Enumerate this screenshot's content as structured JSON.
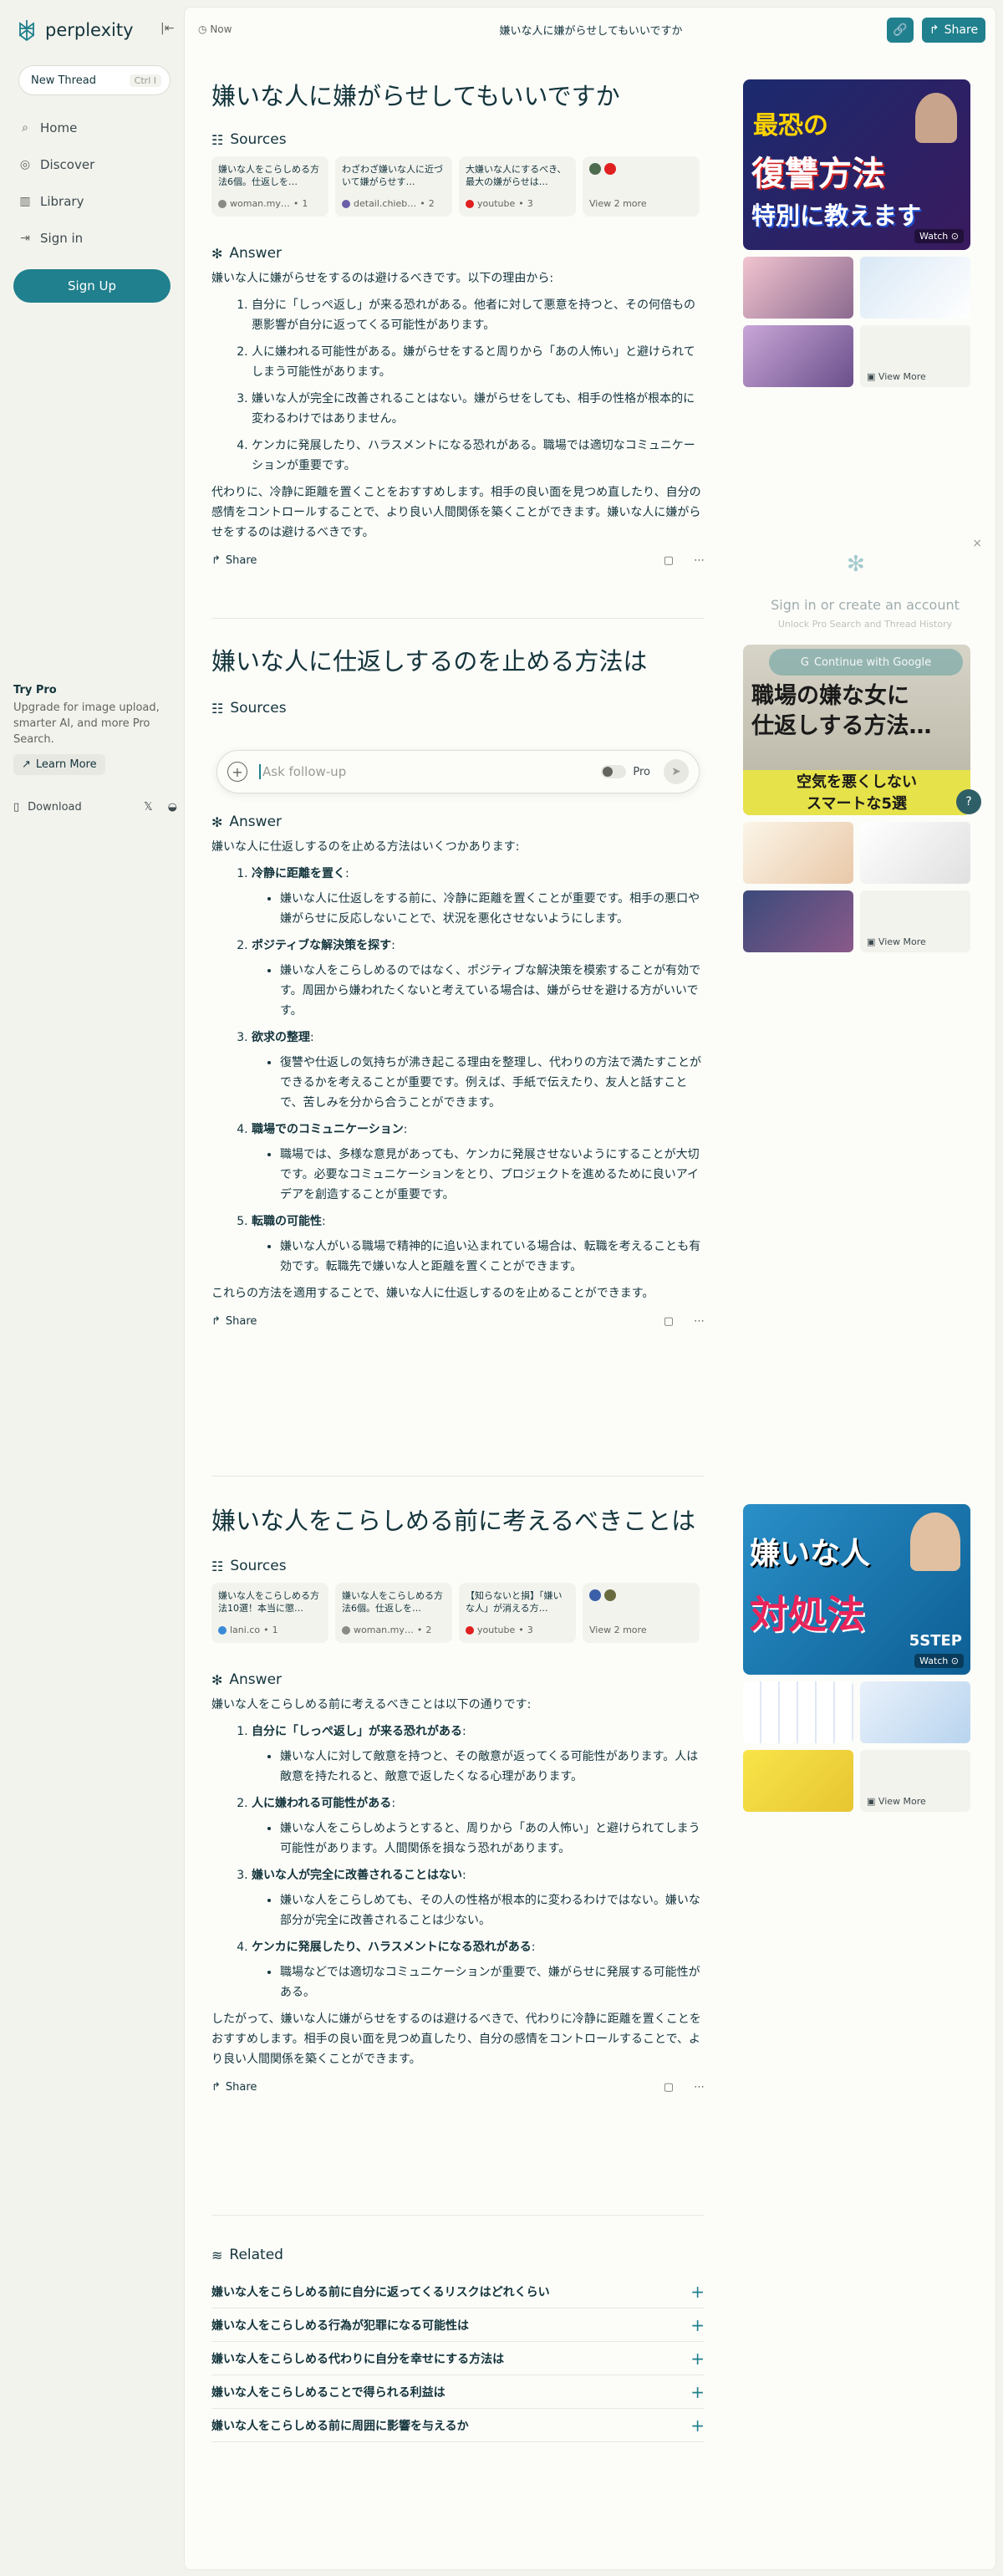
{
  "sidebar": {
    "brand": "perplexity",
    "new_thread": "New Thread",
    "shortcut": "Ctrl I",
    "nav": [
      {
        "label": "Home",
        "icon": "search-icon"
      },
      {
        "label": "Discover",
        "icon": "compass-icon"
      },
      {
        "label": "Library",
        "icon": "library-icon"
      },
      {
        "label": "Sign in",
        "icon": "sign-in-icon"
      }
    ],
    "signup": "Sign Up",
    "try_pro_title": "Try Pro",
    "try_pro_desc": "Upgrade for image upload, smarter AI, and more Pro Search.",
    "learn_more": "Learn More",
    "download": "Download"
  },
  "topbar": {
    "time": "Now",
    "title": "嫌いな人に嫌がらせしてもいいですか",
    "share": "Share"
  },
  "labels": {
    "sources": "Sources",
    "answer": "Answer",
    "share": "Share",
    "view_more": "View More",
    "related": "Related"
  },
  "followup": {
    "placeholder": "Ask follow-up",
    "pro": "Pro"
  },
  "login_overlay": {
    "title": "Sign in or create an account",
    "subtitle": "Unlock Pro Search and Thread History",
    "google": "Continue with Google"
  },
  "threads": [
    {
      "question": "嫌いな人に嫌がらせしてもいいですか",
      "sources": [
        {
          "title": "嫌いな人をこらしめる方法6個。仕返しを…",
          "site": "woman.my…",
          "num": "1",
          "color": "#8a8a85"
        },
        {
          "title": "わざわざ嫌いな人に近づいて嫌がらせす…",
          "site": "detail.chieb…",
          "num": "2",
          "color": "#6b5fa8"
        },
        {
          "title": "大嫌いな人にするべき、最大の嫌がらせは…",
          "site": "youtube",
          "num": "3",
          "color": "#e02020"
        }
      ],
      "more": "View 2 more",
      "intro": "嫌いな人に嫌がらせをするのは避けるべきです。以下の理由から:",
      "items": [
        "自分に「しっぺ返し」が来る恐れがある。他者に対して悪意を持つと、その何倍もの悪影響が自分に返ってくる可能性があります。",
        "人に嫌われる可能性がある。嫌がらせをすると周りから「あの人怖い」と避けられてしまう可能性があります。",
        "嫌いな人が完全に改善されることはない。嫌がらせをしても、相手の性格が根本的に変わるわけではありません。",
        "ケンカに発展したり、ハラスメントになる恐れがある。職場では適切なコミュニケーションが重要です。"
      ],
      "outro": "代わりに、冷静に距離を置くことをおすすめします。相手の良い面を見つめ直したり、自分の感情をコントロールすることで、より良い人間関係を築くことができます。嫌いな人に嫌がらせをするのは避けるべきです。"
    },
    {
      "question": "嫌いな人に仕返しするのを止める方法は",
      "intro": "嫌いな人に仕返しするのを止める方法はいくつかあります:",
      "items": [
        {
          "h": "冷静に距離を置く",
          "d": "嫌いな人に仕返しをする前に、冷静に距離を置くことが重要です。相手の悪口や嫌がらせに反応しないことで、状況を悪化させないようにします。"
        },
        {
          "h": "ポジティブな解決策を探す",
          "d": "嫌いな人をこらしめるのではなく、ポジティブな解決策を模索することが有効です。周囲から嫌われたくないと考えている場合は、嫌がらせを避ける方がいいです。"
        },
        {
          "h": "欲求の整理",
          "d": "復讐や仕返しの気持ちが沸き起こる理由を整理し、代わりの方法で満たすことができるかを考えることが重要です。例えば、手紙で伝えたり、友人と話すことで、苦しみを分から合うことができます。"
        },
        {
          "h": "職場でのコミュニケーション",
          "d": "職場では、多様な意見があっても、ケンカに発展させないようにすることが大切です。必要なコミュニケーションをとり、プロジェクトを進めるために良いアイデアを創造することが重要です。"
        },
        {
          "h": "転職の可能性",
          "d": "嫌いな人がいる職場で精神的に追い込まれている場合は、転職を考えることも有効です。転職先で嫌いな人と距離を置くことができます。"
        }
      ],
      "outro": "これらの方法を適用することで、嫌いな人に仕返しするのを止めることができます。"
    },
    {
      "question": "嫌いな人をこらしめる前に考えるべきことは",
      "sources": [
        {
          "title": "嫌いな人をこらしめる方法10選！本当に懲…",
          "site": "lani.co",
          "num": "1",
          "color": "#3b8ad8"
        },
        {
          "title": "嫌いな人をこらしめる方法6個。仕返しを…",
          "site": "woman.my…",
          "num": "2",
          "color": "#8a8a85"
        },
        {
          "title": "【知らないと損】「嫌いな人」が消える方…",
          "site": "youtube",
          "num": "3",
          "color": "#e02020"
        }
      ],
      "more": "View 2 more",
      "intro": "嫌いな人をこらしめる前に考えるべきことは以下の通りです:",
      "items": [
        {
          "h": "自分に「しっぺ返し」が来る恐れがある",
          "d": "嫌いな人に対して敵意を持つと、その敵意が返ってくる可能性があります。人は敵意を持たれると、敵意で返したくなる心理があります。"
        },
        {
          "h": "人に嫌われる可能性がある",
          "d": "嫌いな人をこらしめようとすると、周りから「あの人怖い」と避けられてしまう可能性があります。人間関係を損なう恐れがあります。"
        },
        {
          "h": "嫌いな人が完全に改善されることはない",
          "d": "嫌いな人をこらしめても、その人の性格が根本的に変わるわけではない。嫌いな部分が完全に改善されることは少ない。"
        },
        {
          "h": "ケンカに発展したり、ハラスメントになる恐れがある",
          "d": "職場などでは適切なコミュニケーションが重要で、嫌がらせに発展する可能性がある。"
        }
      ],
      "outro": "したがって、嫌いな人に嫌がらせをするのは避けるべきで、代わりに冷静に距離を置くことをおすすめします。相手の良い面を見つめ直したり、自分の感情をコントロールすることで、より良い人間関係を築くことができます。"
    }
  ],
  "media": {
    "video1": {
      "line1": "最恐の",
      "line2": "復讐方法",
      "line3": "特別に教えます",
      "watch": "Watch"
    },
    "video2": {
      "line1": "嫌いな人",
      "line2": "対処法",
      "tag": "5STEP",
      "watch": "Watch"
    },
    "image1": {
      "line1": "職場の嫌な女に",
      "line2": "仕返しする方法…",
      "line3": "空気を悪くしない",
      "line4": "スマートな5選"
    }
  },
  "related": [
    "嫌いな人をこらしめる前に自分に返ってくるリスクはどれくらい",
    "嫌いな人をこらしめる行為が犯罪になる可能性は",
    "嫌いな人をこらしめる代わりに自分を幸せにする方法は",
    "嫌いな人をこらしめることで得られる利益は",
    "嫌いな人をこらしめる前に周囲に影響を与えるか"
  ]
}
